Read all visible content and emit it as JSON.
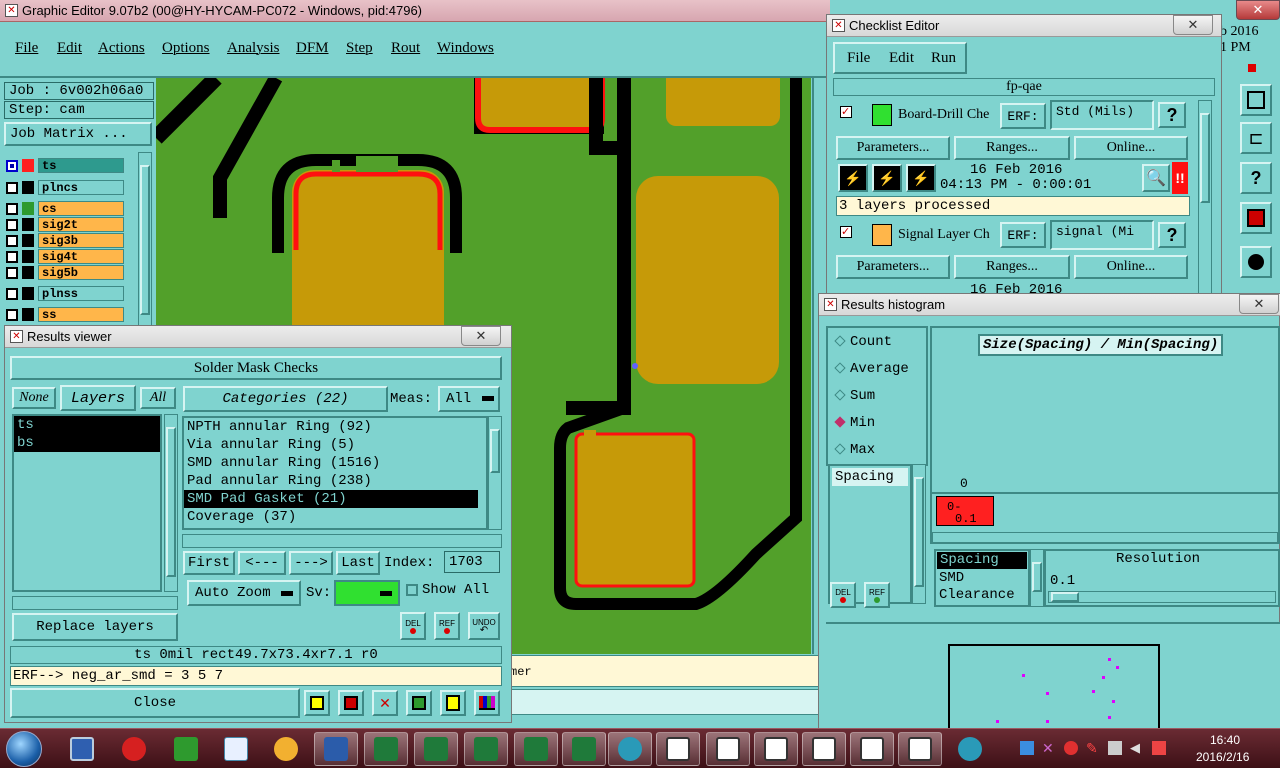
{
  "main": {
    "title": "Graphic Editor 9.07b2 (00@HY-HYCAM-PC072 - Windows, pid:4796)",
    "menu": [
      "File",
      "Edit",
      "Actions",
      "Options",
      "Analysis",
      "DFM",
      "Step",
      "Rout",
      "Windows"
    ],
    "job": "Job : 6v002h06a0",
    "step": "Step: cam",
    "job_matrix": "Job Matrix ...",
    "layers": [
      {
        "name": "ts",
        "color": "#7fd3cf",
        "swatch": "#ff2020",
        "active": true
      },
      {
        "name": "plncs",
        "color": "#7fd3cf",
        "swatch": "#000000"
      },
      {
        "name": "cs",
        "color": "#ffb64a",
        "swatch": "#2e9a2e"
      },
      {
        "name": "sig2t",
        "color": "#ffb64a",
        "swatch": "#000000"
      },
      {
        "name": "sig3b",
        "color": "#ffb64a",
        "swatch": "#000000"
      },
      {
        "name": "sig4t",
        "color": "#ffb64a",
        "swatch": "#000000"
      },
      {
        "name": "sig5b",
        "color": "#ffb64a",
        "swatch": "#000000"
      },
      {
        "name": "plnss",
        "color": "#7fd3cf",
        "swatch": "#000000"
      },
      {
        "name": "ss",
        "color": "#ffb64a",
        "swatch": "#000000"
      }
    ],
    "status_fragment": "mer",
    "date_fragment": "b 2016",
    "time_fragment": "1 PM"
  },
  "results_viewer": {
    "title": "Results viewer",
    "header": "Solder Mask Checks",
    "none": "None",
    "layers": "Layers",
    "all": "All",
    "categories_label": "Categories (22)",
    "meas_label": "Meas:",
    "meas_value": "All",
    "layer_list": [
      "ts",
      "bs"
    ],
    "categories": [
      {
        "label": "NPTH annular Ring (92)"
      },
      {
        "label": "Via annular Ring (5)"
      },
      {
        "label": "SMD annular Ring (1516)"
      },
      {
        "label": "Pad annular Ring (238)"
      },
      {
        "label": "SMD Pad Gasket (21)",
        "selected": true
      },
      {
        "label": "Coverage (37)"
      }
    ],
    "first": "First",
    "prev": "<---",
    "next": "--->",
    "last": "Last",
    "index_label": "Index:",
    "index_value": "1703",
    "auto_zoom": "Auto Zoom",
    "sv_label": "Sv:",
    "show_all": "Show All",
    "replace_layers": "Replace layers",
    "del": "DEL",
    "ref": "REF",
    "undo": "UNDO",
    "info_line": "ts 0mil  rect49.7x73.4xr7.1  r0",
    "erf_line": "ERF--> neg_ar_smd = 3 5 7",
    "close": "Close"
  },
  "checklist": {
    "title": "Checklist Editor",
    "menu": [
      "File",
      "Edit",
      "Run"
    ],
    "name": "fp-qae",
    "check1": {
      "label": "Board-Drill Che",
      "erf_label": "ERF:",
      "erf_value": "Std (Mils)",
      "help": "?",
      "params": "Parameters...",
      "ranges": "Ranges...",
      "online": "Online...",
      "date": "16 Feb 2016",
      "time": "04:13 PM - 0:00:01",
      "status": "3 layers processed"
    },
    "check2": {
      "label": "Signal Layer Ch",
      "erf_label": "ERF:",
      "erf_value": "signal (Mi",
      "help": "?",
      "params": "Parameters...",
      "ranges": "Ranges...",
      "online": "Online...",
      "date": "16 Feb 2016"
    }
  },
  "histogram": {
    "title": "Results histogram",
    "options": [
      {
        "label": "Count"
      },
      {
        "label": "Average"
      },
      {
        "label": "Sum"
      },
      {
        "label": "Min",
        "selected": true
      },
      {
        "label": "Max"
      }
    ],
    "list": [
      "Spacing"
    ],
    "header": "Size(Spacing) / Min(Spacing)",
    "axis_zero": "0",
    "bin_label": "0-",
    "bin_label2": "0.1",
    "resolution_label": "Resolution",
    "resolution_value": "0.1",
    "type_list": [
      "Spacing",
      "SMD",
      "Clearance"
    ],
    "del": "DEL",
    "ref": "REF"
  },
  "taskbar": {
    "time": "16:40",
    "date": "2016/2/16"
  }
}
